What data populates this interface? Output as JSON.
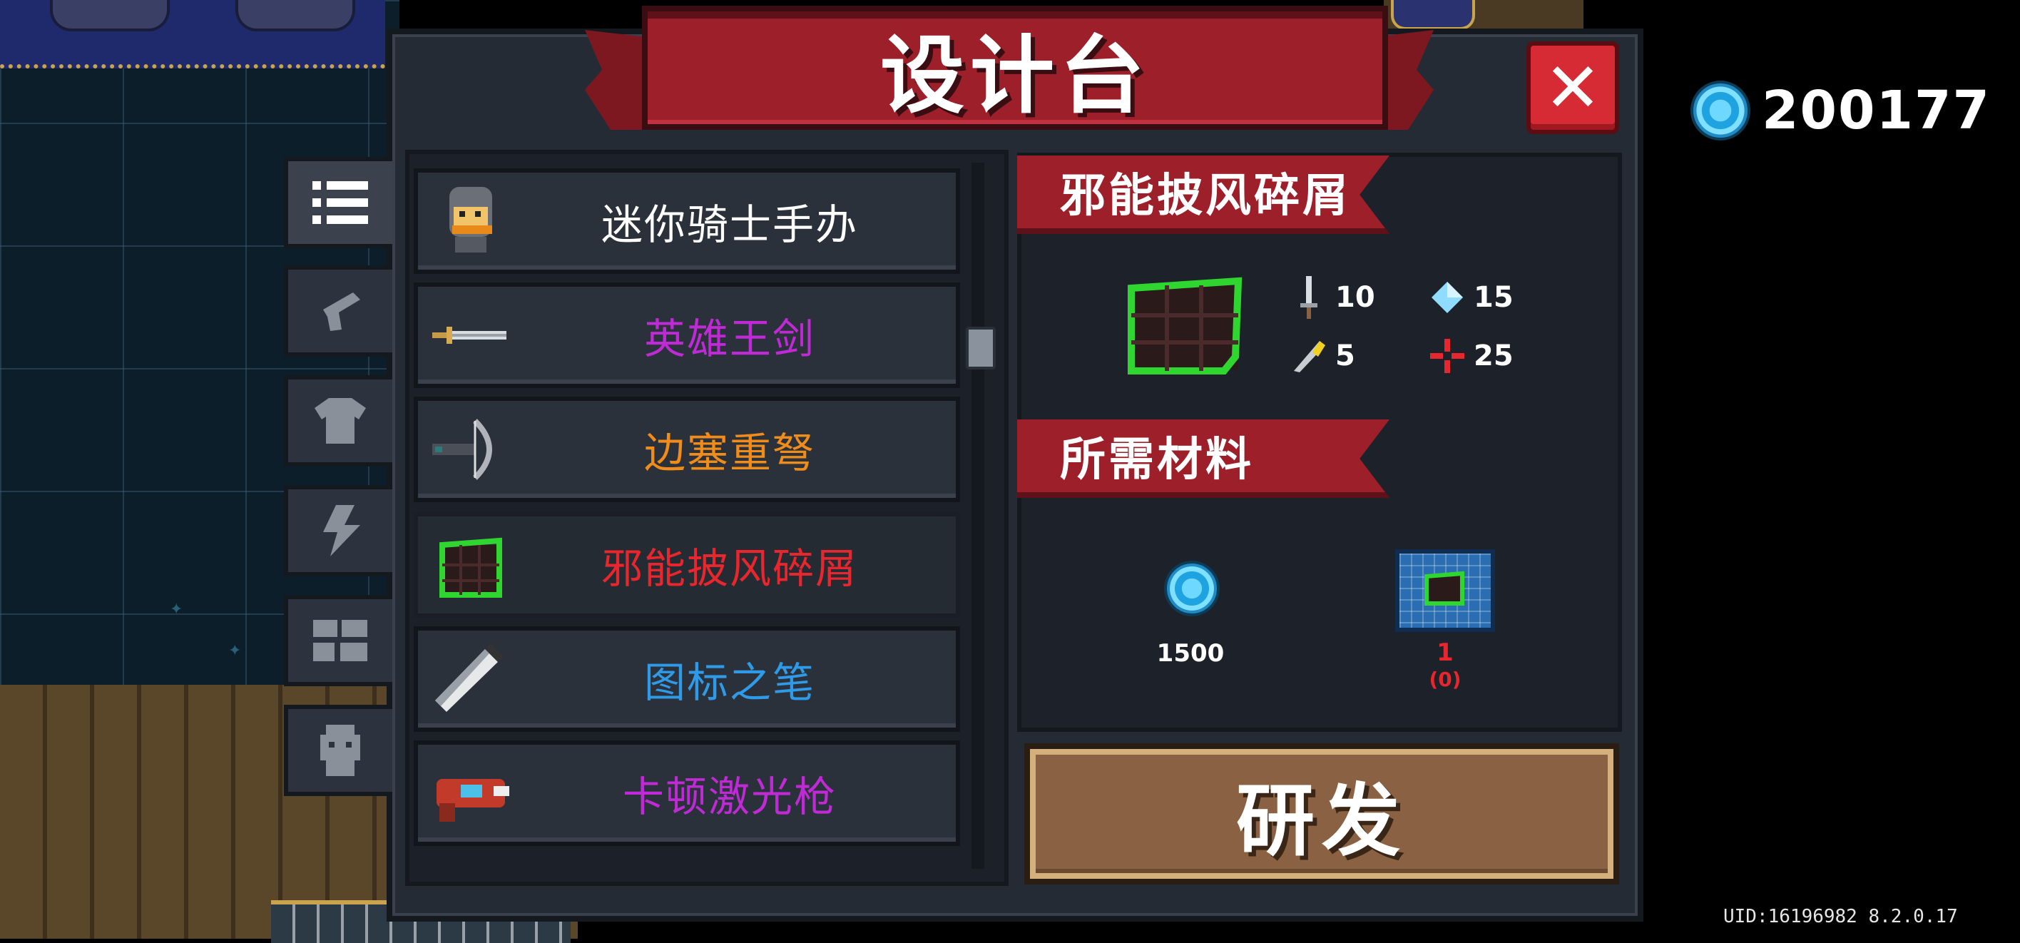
{
  "title": "设计台",
  "currency": {
    "icon": "gem-coin-icon",
    "value": "200177"
  },
  "tabs": [
    {
      "icon": "list-icon",
      "active": true
    },
    {
      "icon": "gun-icon",
      "active": false
    },
    {
      "icon": "armor-icon",
      "active": false
    },
    {
      "icon": "lightning-icon",
      "active": false
    },
    {
      "icon": "blocks-icon",
      "active": false
    },
    {
      "icon": "pet-icon",
      "active": false
    }
  ],
  "items": [
    {
      "label": "迷你骑士手办",
      "color": "#ffffff",
      "icon": "knight-figure-icon"
    },
    {
      "label": "英雄王剑",
      "color": "#c02ad6",
      "icon": "sword-icon"
    },
    {
      "label": "边塞重弩",
      "color": "#f08c1a",
      "icon": "crossbow-icon"
    },
    {
      "label": "邪能披风碎屑",
      "color": "#e8262e",
      "icon": "fel-cloak-icon"
    },
    {
      "label": "图标之笔",
      "color": "#2f9ae8",
      "icon": "pen-icon"
    },
    {
      "label": "卡顿激光枪",
      "color": "#c02ad6",
      "icon": "laser-gun-icon"
    }
  ],
  "detail": {
    "name": "邪能披风碎屑",
    "stats": {
      "attack": "10",
      "energy": "15",
      "speed": "5",
      "crit": "25"
    },
    "materials_title": "所需材料",
    "materials": [
      {
        "icon": "gem-coin-icon",
        "amount": "1500"
      },
      {
        "icon": "blueprint-icon",
        "amount": "1",
        "owned": "(0)"
      }
    ]
  },
  "research_label": "研发",
  "uid": "UID:16196982 8.2.0.17"
}
